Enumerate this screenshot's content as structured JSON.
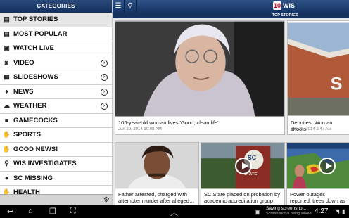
{
  "sidebar": {
    "header": "CATEGORIES",
    "items": [
      {
        "label": "TOP STORIES",
        "icon": "newspaper-icon",
        "glyph": "▤",
        "chevron": false,
        "active": true
      },
      {
        "label": "MOST POPULAR",
        "icon": "newspaper-icon",
        "glyph": "▤",
        "chevron": false,
        "active": false
      },
      {
        "label": "WATCH LIVE",
        "icon": "tv-icon",
        "glyph": "▣",
        "chevron": false,
        "active": false
      },
      {
        "label": "VIDEO",
        "icon": "video-camera-icon",
        "glyph": "◙",
        "chevron": true,
        "active": false
      },
      {
        "label": "SLIDESHOWS",
        "icon": "slideshow-icon",
        "glyph": "▦",
        "chevron": true,
        "active": false
      },
      {
        "label": "NEWS",
        "icon": "microphone-icon",
        "glyph": "♦",
        "chevron": true,
        "active": false
      },
      {
        "label": "WEATHER",
        "icon": "cloud-icon",
        "glyph": "☁",
        "chevron": true,
        "active": false
      },
      {
        "label": "GAMECOCKS",
        "icon": "gamecock-icon",
        "glyph": "■",
        "chevron": false,
        "active": false
      },
      {
        "label": "SPORTS",
        "icon": "thumbs-up-icon",
        "glyph": "✋",
        "chevron": false,
        "active": false
      },
      {
        "label": "GOOD NEWS!",
        "icon": "thumbs-up-icon",
        "glyph": "✋",
        "chevron": false,
        "active": false
      },
      {
        "label": "WIS INVESTIGATES",
        "icon": "magnifier-icon",
        "glyph": "⚲",
        "chevron": false,
        "active": false
      },
      {
        "label": "SC MISSING",
        "icon": "pin-icon",
        "glyph": "●",
        "chevron": false,
        "active": false
      },
      {
        "label": "HEALTH",
        "icon": "thumbs-up-icon",
        "glyph": "✋",
        "chevron": false,
        "active": false
      }
    ]
  },
  "topbar": {
    "logo_number": "10",
    "logo_text": "WIS",
    "section_title": "TOP STORIES"
  },
  "stories": [
    {
      "headline": "105-year-old woman lives 'Good, clean life'",
      "date": "Jun 20, 2014 10:08 AM",
      "has_play": false
    },
    {
      "headline": "Deputies: Woman shoots",
      "date": "Jun 20, 2014 3:47 AM",
      "has_play": false
    },
    {
      "headline": "Father arrested, charged with attempter murder after alleged…",
      "date": "",
      "has_play": false
    },
    {
      "headline": "SC State placed on probation by academic accreditation group",
      "date": "",
      "has_play": true
    },
    {
      "headline": "Power outages reported, trees down as severe storms p…",
      "date": "",
      "has_play": true
    }
  ],
  "system": {
    "notification_title": "Saving screenshot…",
    "notification_sub": "Screenshot is being saved.",
    "clock": "4:27"
  },
  "colors": {
    "header_blue": "#1e3f72",
    "logo_red": "#c0001e"
  }
}
